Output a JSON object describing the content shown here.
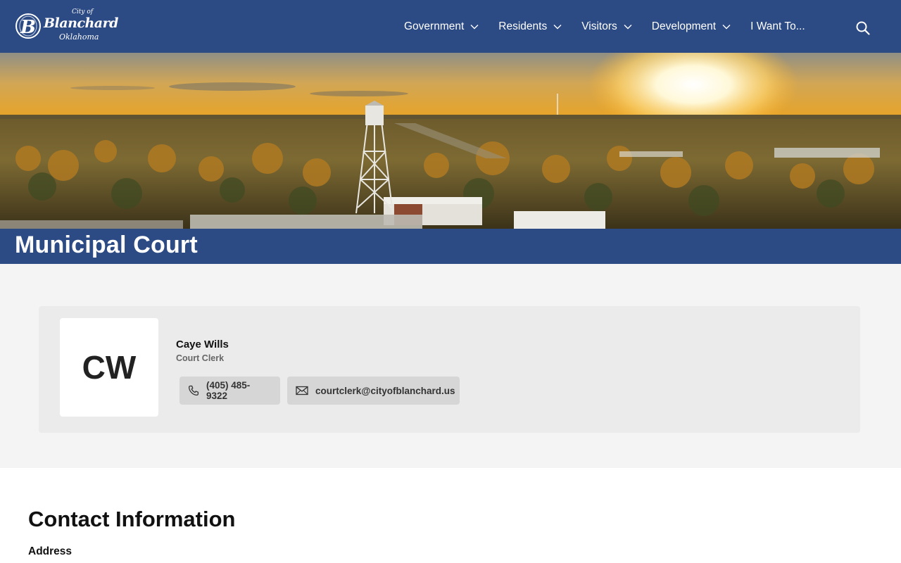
{
  "logo": {
    "city_of": "City of",
    "name": "Blanchard",
    "state": "Oklahoma",
    "monogram": "B"
  },
  "nav": {
    "items": [
      {
        "label": "Government",
        "has_dropdown": true
      },
      {
        "label": "Residents",
        "has_dropdown": true
      },
      {
        "label": "Visitors",
        "has_dropdown": true
      },
      {
        "label": "Development",
        "has_dropdown": true
      },
      {
        "label": "I Want To...",
        "has_dropdown": false
      }
    ],
    "search_icon": "search-icon"
  },
  "page": {
    "title": "Municipal Court"
  },
  "staff": {
    "initials": "CW",
    "name": "Caye Wills",
    "role": "Court Clerk",
    "phone": "(405) 485-9322",
    "email": "courtclerk@cityofblanchard.us"
  },
  "contact": {
    "heading": "Contact Information",
    "address_label": "Address"
  },
  "colors": {
    "brand": "#2c4a83",
    "section_bg": "#f4f4f4",
    "card_bg": "#ebebeb",
    "button_bg": "#d6d6d6"
  }
}
